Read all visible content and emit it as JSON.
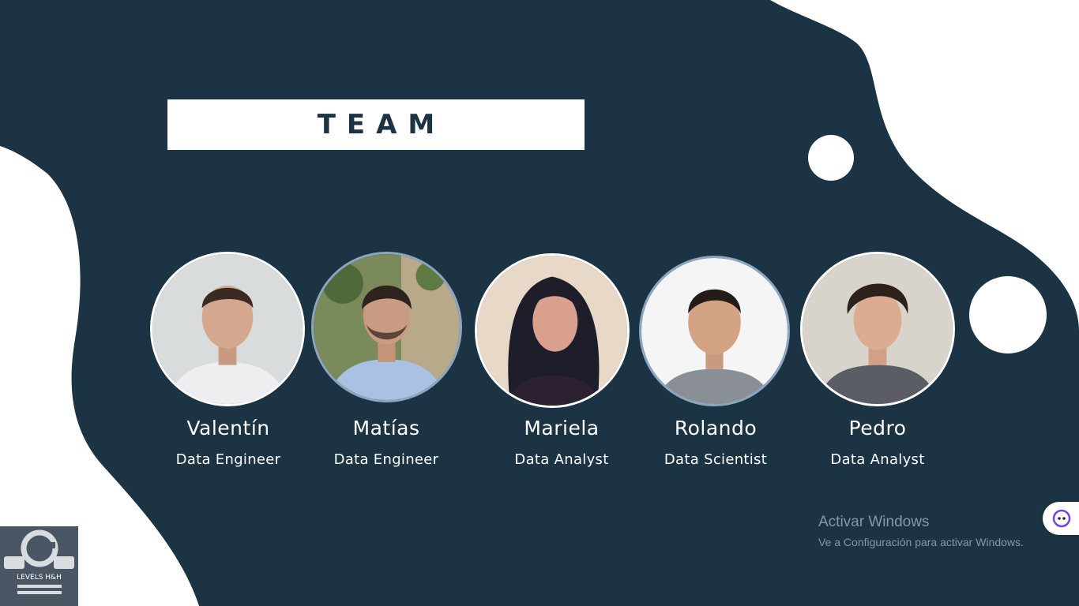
{
  "slide": {
    "title": "TEAM",
    "colors": {
      "background_dark": "#1b3342",
      "background_light": "#ffffff",
      "avatar_border": "#8aa6c1"
    }
  },
  "team": [
    {
      "name": "Valentín",
      "role": "Data Engineer"
    },
    {
      "name": "Matías",
      "role": "Data Engineer"
    },
    {
      "name": "Mariela",
      "role": "Data Analyst"
    },
    {
      "name": "Rolando",
      "role": "Data Scientist"
    },
    {
      "name": "Pedro",
      "role": "Data Analyst"
    }
  ],
  "logo": {
    "text": "LEVELS H&H",
    "icon": "levels-logo-icon"
  },
  "windows_watermark": {
    "title": "Activar Windows",
    "subtitle": "Ve a Configuración para activar Windows."
  },
  "side_widget": {
    "icon": "assistant-face-icon"
  }
}
